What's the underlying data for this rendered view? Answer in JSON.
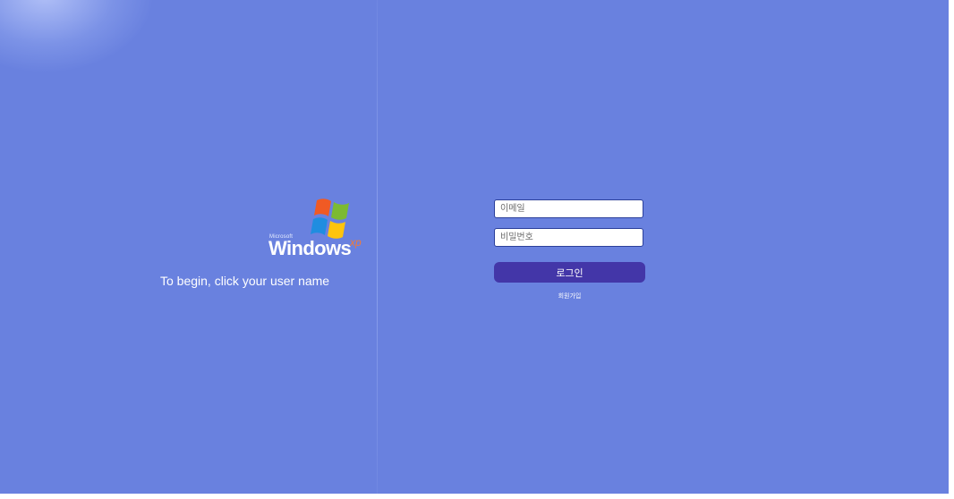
{
  "welcome": {
    "logo": {
      "brand_small": "Microsoft",
      "product_name": "Windows",
      "edition": "xp",
      "icon": "windows-flag-icon"
    },
    "instruction": "To begin, click your user name"
  },
  "login_form": {
    "email_placeholder": "이메일",
    "password_placeholder": "비밀번호",
    "login_label": "로그인",
    "signup_label": "회원가입"
  },
  "colors": {
    "background": "#6981df",
    "button": "#4336a8",
    "field_border": "#2b3f9a",
    "flag_red": "#f05a24",
    "flag_green": "#7cba32",
    "flag_blue": "#1f8de0",
    "flag_yellow": "#ffc40d"
  }
}
